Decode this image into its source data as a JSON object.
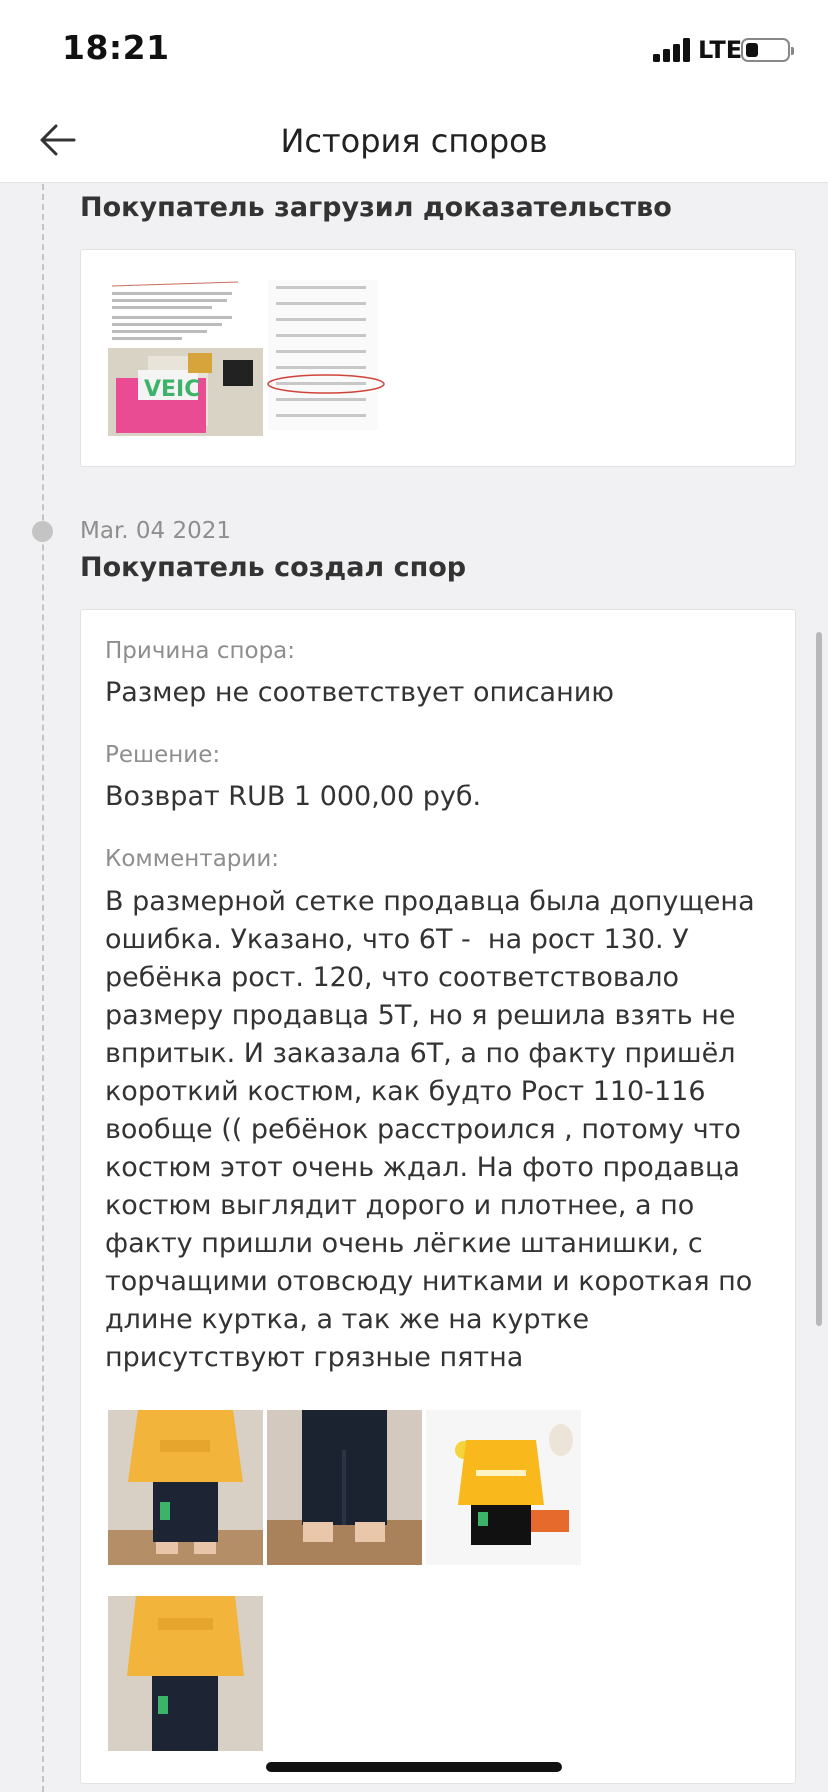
{
  "status_bar": {
    "time": "18:21",
    "network": "LTE",
    "icons": [
      "signal-icon",
      "battery-icon"
    ]
  },
  "header": {
    "title": "История споров",
    "back_icon": "arrow-left-icon"
  },
  "events": [
    {
      "title": "Покупатель загрузил доказательство",
      "attachments": [
        "size-chart-screenshot"
      ]
    },
    {
      "date": "Mar. 04 2021",
      "title": "Покупатель создал спор",
      "reason_label": "Причина спора:",
      "reason_value": "Размер не соответствует описанию",
      "solution_label": "Решение:",
      "solution_value": "Возврат RUB 1 000,00 руб.",
      "comments_label": "Комментарии:",
      "comments_value": "В размерной сетке продавца была допущена ошибка. Указано, что 6T -  на рост 130. У ребёнка рост. 120, что соответствовало размеру продавца 5T, но я решила взять не впритык. И заказала 6T, а по факту пришёл короткий костюм, как будто Рост 110-116 вообще (( ребёнок расстроился , потому что костюм этот очень ждал. На фото продавца костюм выглядит дорого и плотнее, а по факту пришли очень лёгкие штанишки, с торчащими отовсюду нитками и короткая по длине куртка, а так же на куртке присутствуют грязные пятна",
      "attachments": [
        "photo-jacket-front",
        "photo-pants",
        "photo-seller-product",
        "photo-jacket-front-2"
      ]
    }
  ],
  "colors": {
    "background": "#f1f1f3",
    "card": "#ffffff",
    "muted_text": "#8e8e8e",
    "timeline": "#c4c4c4",
    "jacket_yellow": "#f2b43a"
  }
}
